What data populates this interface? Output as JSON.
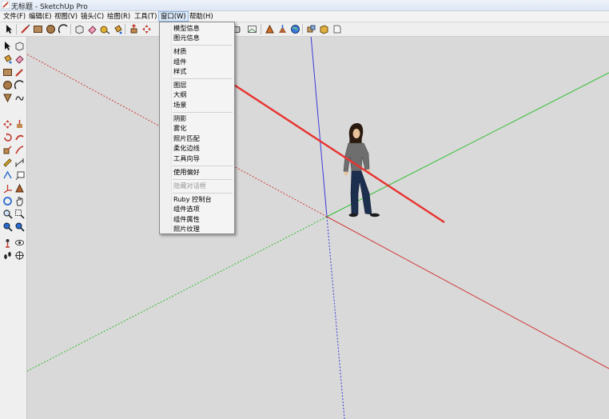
{
  "window": {
    "title": "无标题 - SketchUp Pro"
  },
  "menubar": {
    "items": [
      {
        "label": "文件(F)"
      },
      {
        "label": "编辑(E)"
      },
      {
        "label": "视图(V)"
      },
      {
        "label": "镜头(C)"
      },
      {
        "label": "绘图(R)"
      },
      {
        "label": "工具(T)"
      },
      {
        "label": "窗口(W)"
      },
      {
        "label": "帮助(H)"
      }
    ],
    "active_index": 6
  },
  "window_menu": {
    "items": [
      {
        "label": "模型信息"
      },
      {
        "label": "图元信息"
      },
      {
        "label": "材质"
      },
      {
        "label": "组件"
      },
      {
        "label": "样式"
      },
      {
        "label": "图层"
      },
      {
        "label": "大纲"
      },
      {
        "label": "场景"
      },
      {
        "label": "阴影"
      },
      {
        "label": "雾化"
      },
      {
        "label": "照片匹配"
      },
      {
        "label": "柔化边线"
      },
      {
        "label": "工具向导"
      },
      {
        "label": "使用偏好"
      },
      {
        "label": "隐藏对话框",
        "disabled": true
      },
      {
        "label": "Ruby 控制台"
      },
      {
        "label": "组件选项"
      },
      {
        "label": "组件属性"
      },
      {
        "label": "照片纹理"
      }
    ]
  },
  "colors": {
    "axis_blue": "#3a3ad8",
    "axis_green": "#2fbf2f",
    "axis_red": "#d23c3c",
    "annotation_arrow": "#e8332f",
    "viewport_bg": "#d9d9d9"
  }
}
